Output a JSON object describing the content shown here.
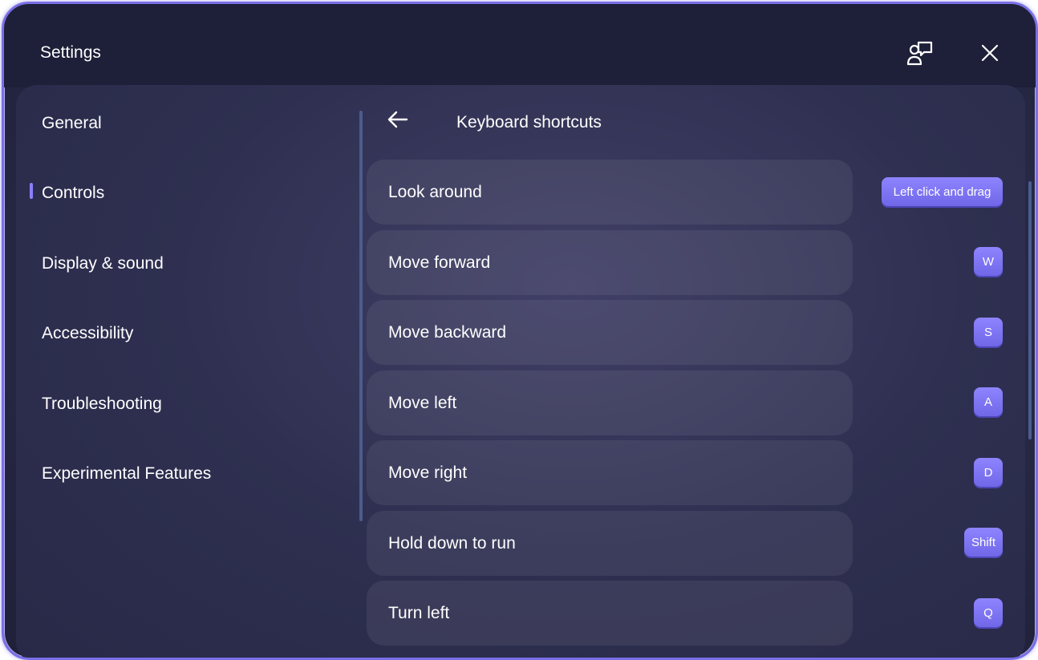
{
  "window": {
    "title": "Settings"
  },
  "nav": {
    "items": [
      {
        "label": "General"
      },
      {
        "label": "Controls",
        "selected": true
      },
      {
        "label": "Display & sound"
      },
      {
        "label": "Accessibility"
      },
      {
        "label": "Troubleshooting"
      },
      {
        "label": "Experimental Features"
      }
    ]
  },
  "page": {
    "title": "Keyboard shortcuts"
  },
  "shortcuts": [
    {
      "action": "Look around",
      "key": "Left click and drag"
    },
    {
      "action": "Move forward",
      "key": "W"
    },
    {
      "action": "Move backward",
      "key": "S"
    },
    {
      "action": "Move left",
      "key": "A"
    },
    {
      "action": "Move right",
      "key": "D"
    },
    {
      "action": "Hold down to run",
      "key": "Shift"
    },
    {
      "action": "Turn left",
      "key": "Q"
    }
  ],
  "icons": {
    "feedback": "feedback-icon",
    "close": "close-icon",
    "back": "back-arrow-icon"
  },
  "colors": {
    "accent": "#8a80ff",
    "key_background": "#7a70f2"
  }
}
